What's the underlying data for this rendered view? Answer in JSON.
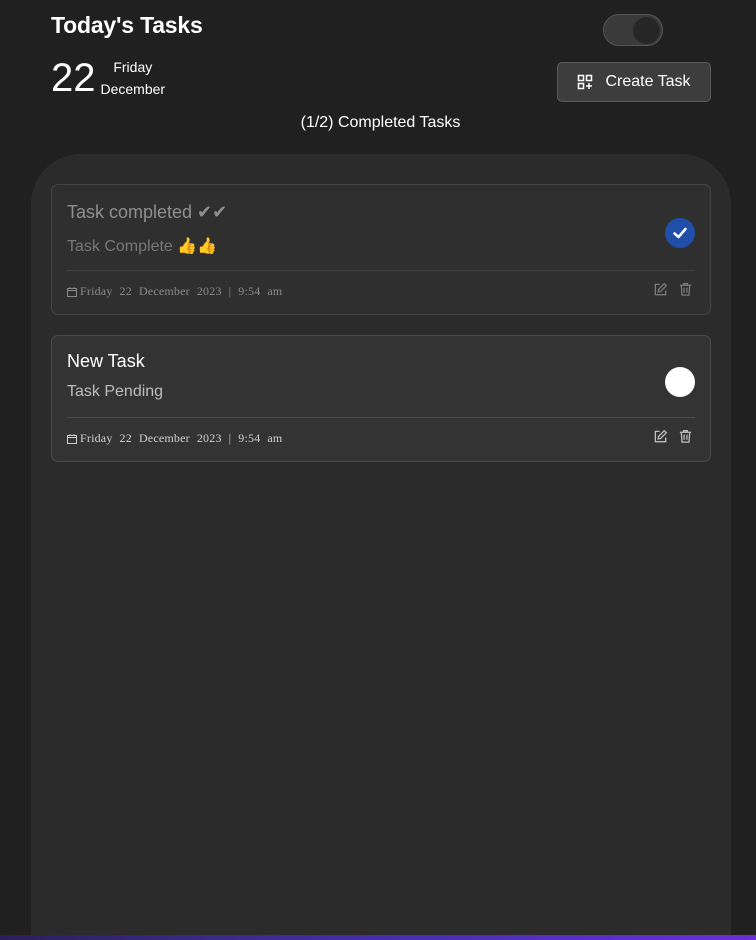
{
  "header": {
    "title": "Today's Tasks",
    "day_number": "22",
    "weekday": "Friday",
    "month": "December",
    "create_button_label": "Create Task",
    "create_icon": "qr-add-icon",
    "theme_toggle_state": "off"
  },
  "summary": {
    "completed_text": "(1/2) Completed Tasks"
  },
  "tasks": [
    {
      "title": "Task completed ✔✔",
      "description": "Task Complete 👍👍",
      "date_parts": [
        "Friday",
        "22",
        "December",
        "2023",
        "|",
        "9:54",
        "am"
      ],
      "completed": true,
      "status_color": "#1f4fa8"
    },
    {
      "title": "New Task",
      "description": "Task Pending",
      "date_parts": [
        "Friday",
        "22",
        "December",
        "2023",
        "|",
        "9:54",
        "am"
      ],
      "completed": false,
      "status_color": "#ffffff"
    }
  ],
  "colors": {
    "background": "#202020",
    "panel": "#2b2b2b",
    "accent_blue": "#1f4fa8"
  }
}
